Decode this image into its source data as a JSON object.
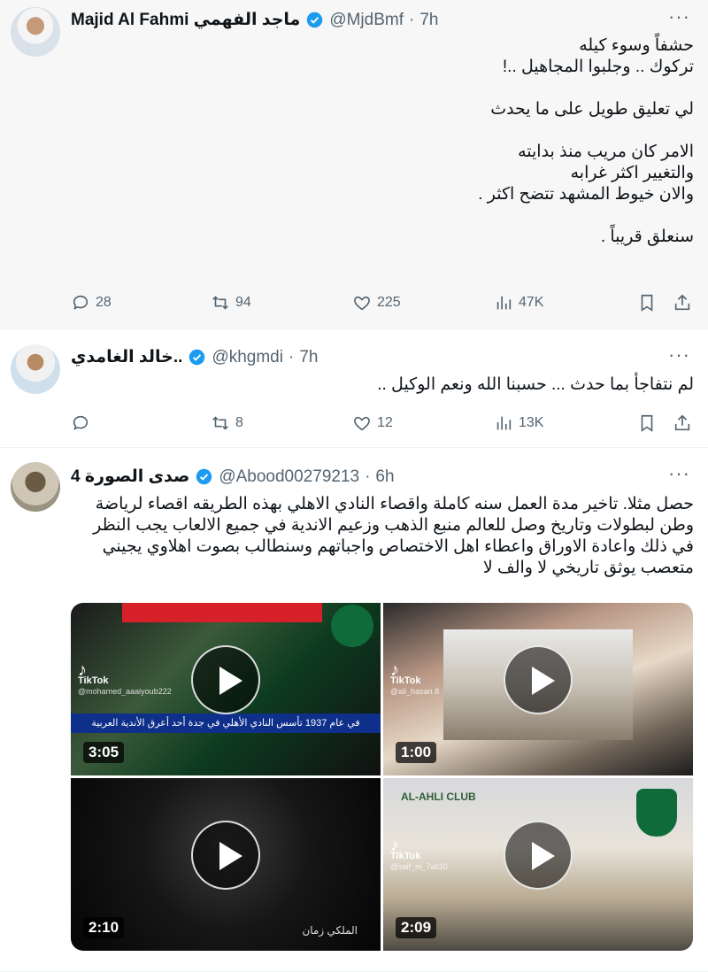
{
  "tweets": [
    {
      "author_name": "Majid Al Fahmi ماجد الفهمي",
      "handle": "@MjdBmf",
      "separator": "·",
      "time": "7h",
      "more": "···",
      "text": "حشفاً وسوء كيله\nتركوك .. وجلبوا المجاهيل ..!\n\nلي تعليق طويل على ما يحدث\n\nالامر كان مريب منذ بدايته\nوالتغيير اكثر غرابه\nوالان خيوط المشهد تتضح اكثر .\n\nسنعلق قريباً .",
      "stats": {
        "replies": "28",
        "retweets": "94",
        "likes": "225",
        "views": "47K"
      }
    },
    {
      "author_name": "خالد الغامدي..",
      "handle": "@khgmdi",
      "separator": "·",
      "time": "7h",
      "more": "···",
      "text": "لم نتفاجأ بما حدث  ... حسبنا الله ونعم الوكيل ..",
      "stats": {
        "replies": "",
        "retweets": "8",
        "likes": "12",
        "views": "13K"
      }
    },
    {
      "author_name": "صدى الصورة 4",
      "handle": "@Abood00279213",
      "separator": "·",
      "time": "6h",
      "more": "···",
      "text": "حصل مثلا. تاخير  مدة العمل سنه كاملة واقصاء النادي الاهلي بهذه الطريقه اقصاء لرياضة وطن لبطولات وتاريخ وصل للعالم منبع الذهب وزعيم الاندية في جميع الالعاب يجب النظر في ذلك واعادة الاوراق واعطاء اهل الاختصاص واجباتهم وسنطالب بصوت اهلاوي يجيني متعصب يوثق تاريخي لا والف لا",
      "videos": [
        {
          "duration": "3:05",
          "tiktok": "TikTok",
          "tiktok_user": "@mohamed_aaaiyoub222",
          "banner": "في عام 1937 تأسس النادي الأهلي في جدة أحد أعرق الأندية العربية"
        },
        {
          "duration": "1:00",
          "tiktok": "TikTok",
          "tiktok_user": "@ali_hasan.8"
        },
        {
          "duration": "2:10",
          "caption": "الملكي زمان"
        },
        {
          "duration": "2:09",
          "tiktok": "TikTok",
          "tiktok_user": "@saif_m_7ali20",
          "sign": "AL-AHLI CLUB"
        }
      ]
    }
  ],
  "icons": {
    "reply": "reply-icon",
    "retweet": "retweet-icon",
    "like": "heart-icon",
    "views": "views-icon",
    "bookmark": "bookmark-icon",
    "share": "share-icon",
    "verified": "verified-badge-icon",
    "play": "play-icon"
  },
  "colors": {
    "verified": "#1d9bf0",
    "muted": "#536471",
    "text": "#0f1419"
  }
}
